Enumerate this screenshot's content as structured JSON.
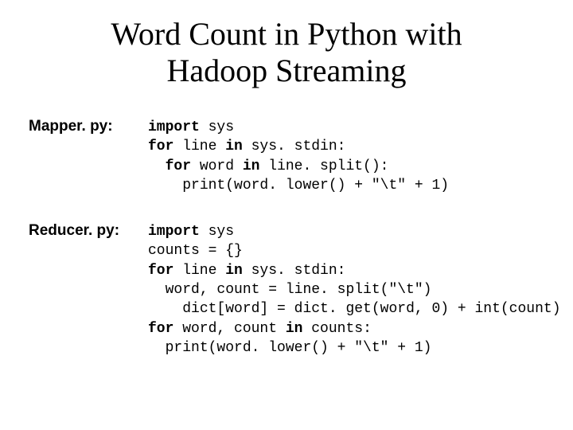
{
  "title_line1": "Word Count in Python with",
  "title_line2": "Hadoop Streaming",
  "mapper": {
    "label": "Mapper. py:",
    "kw_import": "import",
    "t_sys": " sys",
    "kw_for1": "for",
    "t_line_in": " line ",
    "kw_in1": "in",
    "t_sys_stdin": " sys. stdin:",
    "indent1": "  ",
    "kw_for2": "for",
    "t_word_in": " word ",
    "kw_in2": "in",
    "t_line_split": " line. split():",
    "indent2": "    ",
    "t_print": "print(word. lower() + \"\\t\" + 1)"
  },
  "reducer": {
    "label": "Reducer. py:",
    "kw_import": "import",
    "t_sys": " sys",
    "t_counts": "counts = {}",
    "kw_for1": "for",
    "t_line_in": " line ",
    "kw_in1": "in",
    "t_sys_stdin": " sys. stdin:",
    "indent1": "  ",
    "t_wc_split": "word, count = line. split(\"\\t\")",
    "indent2": "    ",
    "t_dict": "dict[word] = dict. get(word, 0) + int(count)",
    "kw_for2": "for",
    "t_wc_in": " word, count ",
    "kw_in2": "in",
    "t_counts2": " counts:",
    "indent3": "  ",
    "t_print": "print(word. lower() + \"\\t\" + 1)"
  }
}
